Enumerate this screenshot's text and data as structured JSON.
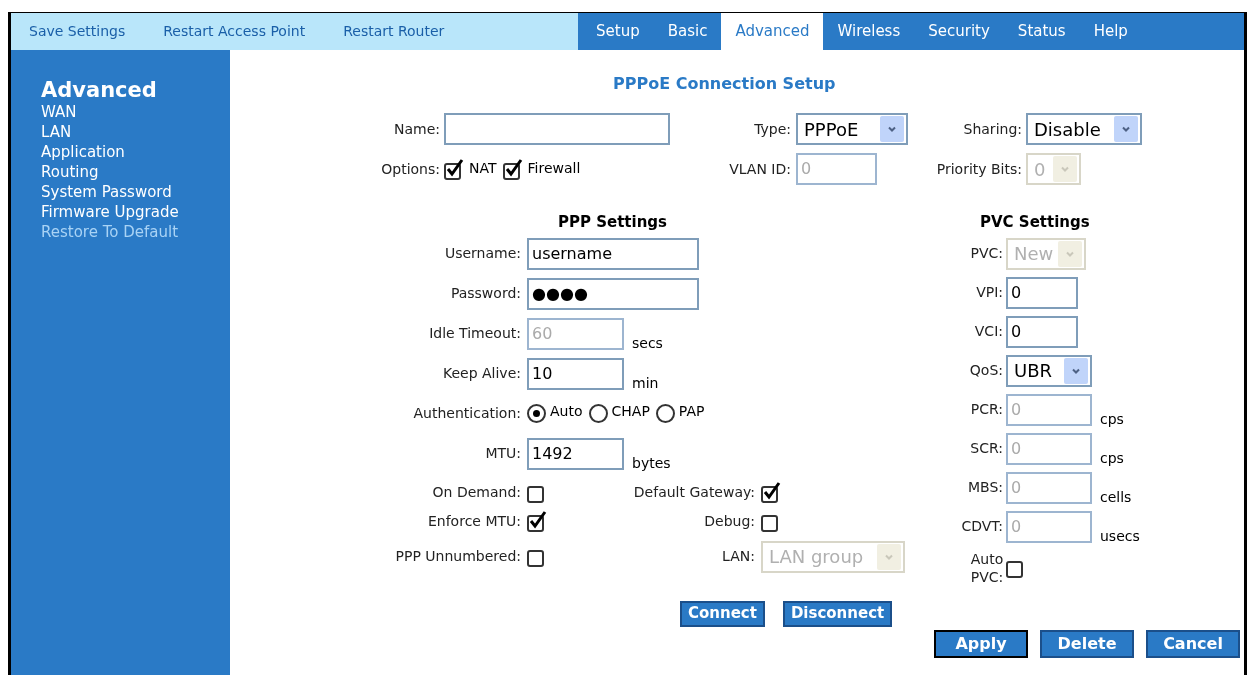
{
  "top_links": [
    {
      "label": "Save Settings"
    },
    {
      "label": "Restart Access Point"
    },
    {
      "label": "Restart Router"
    }
  ],
  "tabs": [
    {
      "label": "Setup",
      "selected": false
    },
    {
      "label": "Basic",
      "selected": false
    },
    {
      "label": "Advanced",
      "selected": true
    },
    {
      "label": "Wireless",
      "selected": false
    },
    {
      "label": "Security",
      "selected": false
    },
    {
      "label": "Status",
      "selected": false
    },
    {
      "label": "Help",
      "selected": false
    }
  ],
  "sidebar": {
    "title": "Advanced",
    "items": [
      {
        "label": "WAN",
        "highlighted": false
      },
      {
        "label": "LAN",
        "highlighted": false
      },
      {
        "label": "Application",
        "highlighted": false
      },
      {
        "label": "Routing",
        "highlighted": false
      },
      {
        "label": "System Password",
        "highlighted": false
      },
      {
        "label": "Firmware Upgrade",
        "highlighted": false
      },
      {
        "label": "Restore To Default",
        "highlighted": true
      }
    ]
  },
  "title": "PPPoE Connection Setup",
  "general": {
    "name": {
      "label": "Name:",
      "kind": "text",
      "disabled": false
    },
    "type": {
      "label": "Type:",
      "kind": "select",
      "value": "PPPoE",
      "disabled": false
    },
    "sharing": {
      "label": "Sharing:",
      "kind": "select",
      "value": "Disable",
      "disabled": false
    },
    "options": {
      "label": "Options:",
      "items": [
        {
          "label": "NAT",
          "checked": true
        },
        {
          "label": "Firewall",
          "checked": true
        }
      ]
    },
    "vlan_id": {
      "label": "VLAN ID:",
      "kind": "text",
      "value": "0",
      "disabled": true
    },
    "priority_bits": {
      "label": "Priority Bits:",
      "kind": "select",
      "value": "0",
      "disabled": true
    }
  },
  "ppp_settings": {
    "heading": "PPP Settings",
    "fields": [
      {
        "label": "Username:",
        "kind": "text",
        "value": "username",
        "disabled": false
      },
      {
        "label": "Password:",
        "kind": "password",
        "value": "●●●●",
        "disabled": false
      },
      {
        "label": "Idle Timeout:",
        "kind": "text",
        "value": "60",
        "disabled": true,
        "unit": "secs"
      },
      {
        "label": "Keep Alive:",
        "kind": "text",
        "value": "10",
        "disabled": false,
        "unit": "min"
      },
      {
        "label": "Authentication:",
        "kind": "radio",
        "options": [
          {
            "label": "Auto",
            "selected": true
          },
          {
            "label": "CHAP",
            "selected": false
          },
          {
            "label": "PAP",
            "selected": false
          }
        ]
      },
      {
        "label": "MTU:",
        "kind": "text",
        "value": "1492",
        "disabled": false,
        "unit": "bytes"
      }
    ],
    "flag_rows": [
      [
        {
          "label": "On Demand:",
          "kind": "checkbox",
          "checked": false
        },
        {
          "label": "Default Gateway:",
          "kind": "checkbox",
          "checked": true
        }
      ],
      [
        {
          "label": "Enforce MTU:",
          "kind": "checkbox",
          "checked": true
        },
        {
          "label": "Debug:",
          "kind": "checkbox",
          "checked": false
        }
      ],
      [
        {
          "label": "PPP Unnumbered:",
          "kind": "checkbox",
          "checked": false
        },
        {
          "label": "LAN:",
          "kind": "select",
          "value": "LAN group",
          "disabled": true
        }
      ]
    ],
    "buttons": [
      {
        "label": "Connect"
      },
      {
        "label": "Disconnect"
      }
    ]
  },
  "pvc_settings": {
    "heading": "PVC Settings",
    "fields": [
      {
        "label": "PVC:",
        "kind": "select",
        "value": "New",
        "disabled": true
      },
      {
        "label": "VPI:",
        "kind": "text",
        "value": "0",
        "disabled": false
      },
      {
        "label": "VCI:",
        "kind": "text",
        "value": "0",
        "disabled": false
      },
      {
        "label": "QoS:",
        "kind": "select",
        "value": "UBR",
        "disabled": false
      },
      {
        "label": "PCR:",
        "kind": "text",
        "value": "0",
        "disabled": true,
        "unit": "cps"
      },
      {
        "label": "SCR:",
        "kind": "text",
        "value": "0",
        "disabled": true,
        "unit": "cps"
      },
      {
        "label": "MBS:",
        "kind": "text",
        "value": "0",
        "disabled": true,
        "unit": "cells"
      },
      {
        "label": "CDVT:",
        "kind": "text",
        "value": "0",
        "disabled": true,
        "unit": "usecs"
      },
      {
        "label": "Auto PVC:",
        "kind": "checkbox",
        "checked": false
      }
    ]
  },
  "actions": [
    {
      "label": "Apply",
      "default": true
    },
    {
      "label": "Delete",
      "default": false
    },
    {
      "label": "Cancel",
      "default": false
    }
  ]
}
